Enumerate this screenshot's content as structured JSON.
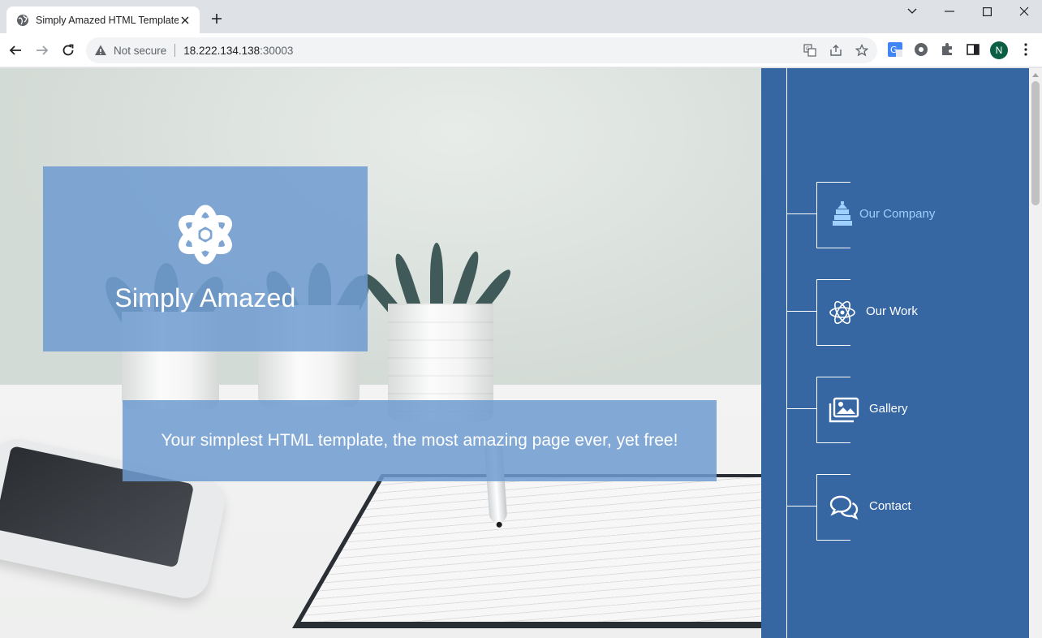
{
  "browser": {
    "tab_title": "Simply Amazed HTML Template",
    "security_label": "Not secure",
    "url_host": "18.222.134.138",
    "url_port": ":30003",
    "profile_initial": "N"
  },
  "hero": {
    "brand_title": "Simply Amazed",
    "tagline": "Your simplest HTML template, the most amazing page ever, yet free!"
  },
  "nav": {
    "items": [
      {
        "label": "Our Company",
        "icon": "building-icon",
        "active": true
      },
      {
        "label": "Our Work",
        "icon": "atom-icon",
        "active": false
      },
      {
        "label": "Gallery",
        "icon": "images-icon",
        "active": false
      },
      {
        "label": "Contact",
        "icon": "chat-bubbles-icon",
        "active": false
      }
    ]
  },
  "colors": {
    "sidebar_bg": "#3667a3",
    "box_overlay": "#6e9bd0",
    "active_nav": "#9fd0ff"
  }
}
